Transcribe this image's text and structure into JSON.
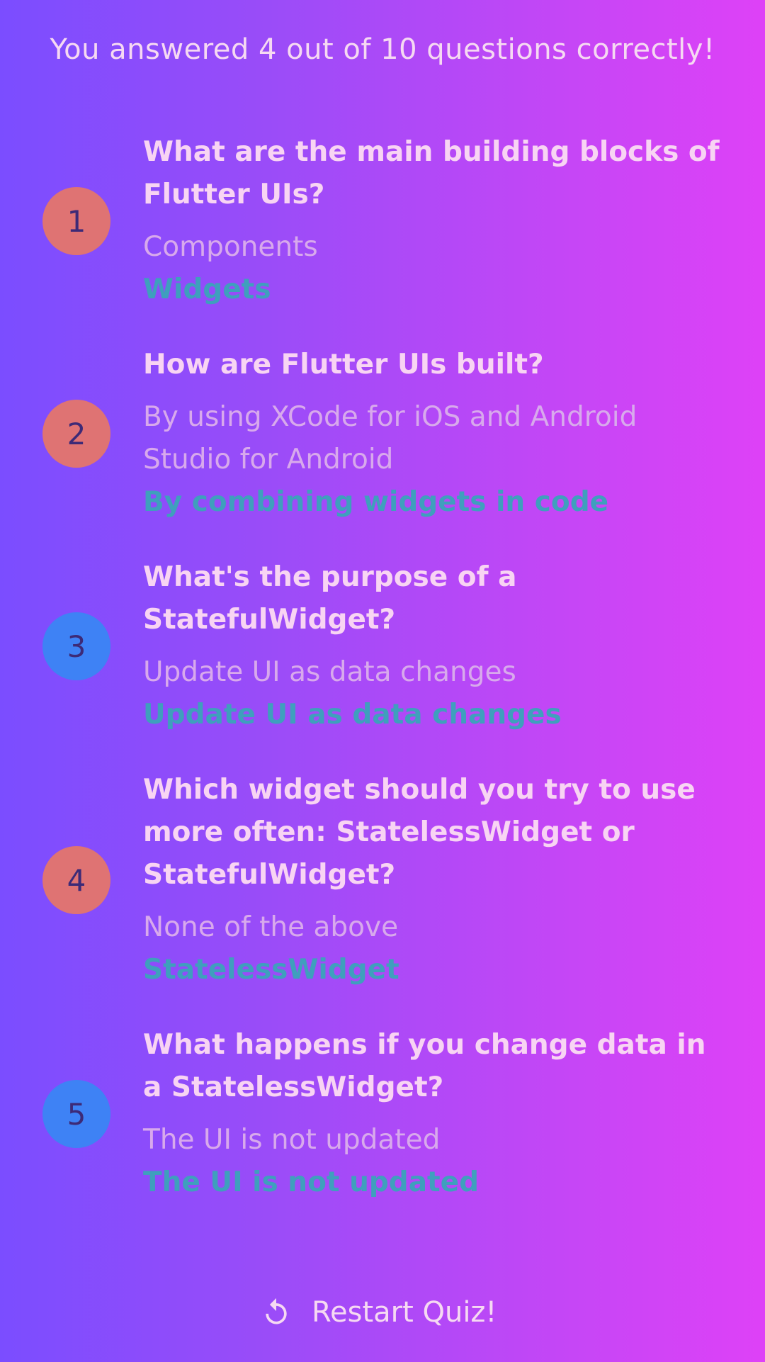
{
  "summary": {
    "title": "You answered 4 out of 10 questions correctly!"
  },
  "results": [
    {
      "index": "1",
      "status": "wrong",
      "question": "What are the main building blocks of Flutter UIs?",
      "user_answer": "Components",
      "correct_answer": "Widgets"
    },
    {
      "index": "2",
      "status": "wrong",
      "question": "How are Flutter UIs built?",
      "user_answer": "By using XCode for iOS and Android Studio for Android",
      "correct_answer": "By combining widgets in code"
    },
    {
      "index": "3",
      "status": "correct",
      "question": "What's the purpose of a StatefulWidget?",
      "user_answer": "Update UI as data changes",
      "correct_answer": "Update UI as data changes"
    },
    {
      "index": "4",
      "status": "wrong",
      "question": "Which widget should you try to use more often: StatelessWidget or StatefulWidget?",
      "user_answer": "None of the above",
      "correct_answer": "StatelessWidget"
    },
    {
      "index": "5",
      "status": "correct",
      "question": "What happens if you change data in a StatelessWidget?",
      "user_answer": "The UI is not updated",
      "correct_answer": "The UI is not updated"
    }
  ],
  "restart": {
    "label": "Restart Quiz!",
    "icon": "restart-icon"
  },
  "colors": {
    "wrong_badge": "#df7373",
    "correct_badge": "#3e82f5",
    "correct_answer_text": "#3f9fbd"
  }
}
